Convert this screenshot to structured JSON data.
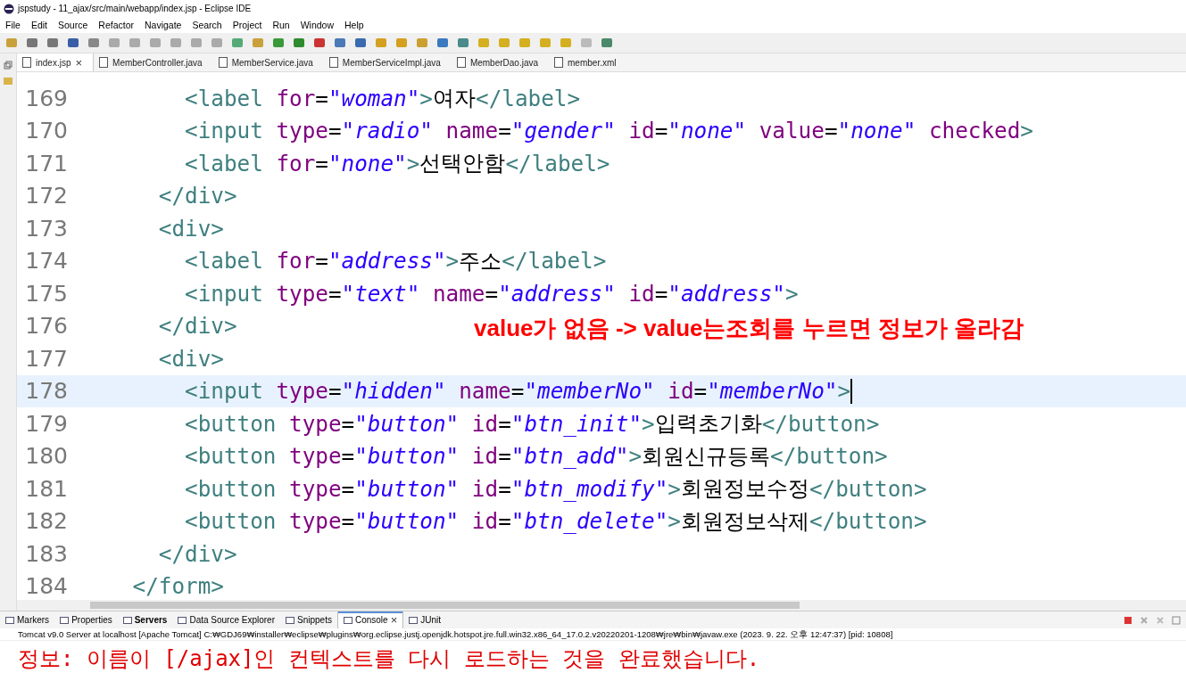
{
  "window": {
    "title": "jspstudy - 11_ajax/src/main/webapp/index.jsp - Eclipse IDE"
  },
  "menu": [
    "File",
    "Edit",
    "Source",
    "Refactor",
    "Navigate",
    "Search",
    "Project",
    "Run",
    "Window",
    "Help"
  ],
  "editor_tabs": [
    {
      "label": "index.jsp",
      "selected": true,
      "close": "×"
    },
    {
      "label": "MemberController.java",
      "selected": false
    },
    {
      "label": "MemberService.java",
      "selected": false
    },
    {
      "label": "MemberServiceImpl.java",
      "selected": false
    },
    {
      "label": "MemberDao.java",
      "selected": false
    },
    {
      "label": "member.xml",
      "selected": false
    }
  ],
  "code_lines": [
    {
      "number": "169",
      "current": false,
      "tokens": [
        {
          "kind": "tag",
          "text": "        <label"
        },
        {
          "kind": "attr",
          "text": " for"
        },
        {
          "kind": "eq",
          "text": "="
        },
        {
          "kind": "str",
          "text": "\"woman\""
        },
        {
          "kind": "tag",
          "text": ">"
        },
        {
          "kind": "text",
          "text": "여자"
        },
        {
          "kind": "tag",
          "text": "</label>"
        }
      ]
    },
    {
      "number": "170",
      "current": false,
      "tokens": [
        {
          "kind": "tag",
          "text": "        <input"
        },
        {
          "kind": "attr",
          "text": " type"
        },
        {
          "kind": "eq",
          "text": "="
        },
        {
          "kind": "str",
          "text": "\"radio\""
        },
        {
          "kind": "attr",
          "text": " name"
        },
        {
          "kind": "eq",
          "text": "="
        },
        {
          "kind": "str",
          "text": "\"gender\""
        },
        {
          "kind": "attr",
          "text": " id"
        },
        {
          "kind": "eq",
          "text": "="
        },
        {
          "kind": "str",
          "text": "\"none\""
        },
        {
          "kind": "attr",
          "text": " value"
        },
        {
          "kind": "eq",
          "text": "="
        },
        {
          "kind": "str",
          "text": "\"none\""
        },
        {
          "kind": "attr",
          "text": " checked"
        },
        {
          "kind": "tag",
          "text": ">"
        }
      ]
    },
    {
      "number": "171",
      "current": false,
      "tokens": [
        {
          "kind": "tag",
          "text": "        <label"
        },
        {
          "kind": "attr",
          "text": " for"
        },
        {
          "kind": "eq",
          "text": "="
        },
        {
          "kind": "str",
          "text": "\"none\""
        },
        {
          "kind": "tag",
          "text": ">"
        },
        {
          "kind": "text",
          "text": "선택안함"
        },
        {
          "kind": "tag",
          "text": "</label>"
        }
      ]
    },
    {
      "number": "172",
      "current": false,
      "tokens": [
        {
          "kind": "tag",
          "text": "      </div>"
        }
      ]
    },
    {
      "number": "173",
      "current": false,
      "tokens": [
        {
          "kind": "tag",
          "text": "      <div>"
        }
      ]
    },
    {
      "number": "174",
      "current": false,
      "tokens": [
        {
          "kind": "tag",
          "text": "        <label"
        },
        {
          "kind": "attr",
          "text": " for"
        },
        {
          "kind": "eq",
          "text": "="
        },
        {
          "kind": "str",
          "text": "\"address\""
        },
        {
          "kind": "tag",
          "text": ">"
        },
        {
          "kind": "text",
          "text": "주소"
        },
        {
          "kind": "tag",
          "text": "</label>"
        }
      ]
    },
    {
      "number": "175",
      "current": false,
      "tokens": [
        {
          "kind": "tag",
          "text": "        <input"
        },
        {
          "kind": "attr",
          "text": " type"
        },
        {
          "kind": "eq",
          "text": "="
        },
        {
          "kind": "str",
          "text": "\"text\""
        },
        {
          "kind": "attr",
          "text": " name"
        },
        {
          "kind": "eq",
          "text": "="
        },
        {
          "kind": "str",
          "text": "\"address\""
        },
        {
          "kind": "attr",
          "text": " id"
        },
        {
          "kind": "eq",
          "text": "="
        },
        {
          "kind": "str",
          "text": "\"address\""
        },
        {
          "kind": "tag",
          "text": ">"
        }
      ]
    },
    {
      "number": "176",
      "current": false,
      "tokens": [
        {
          "kind": "tag",
          "text": "      </div>"
        }
      ]
    },
    {
      "number": "177",
      "current": false,
      "tokens": [
        {
          "kind": "tag",
          "text": "      <div>"
        }
      ]
    },
    {
      "number": "178",
      "current": true,
      "tokens": [
        {
          "kind": "tag",
          "text": "        <input"
        },
        {
          "kind": "attr",
          "text": " type"
        },
        {
          "kind": "eq",
          "text": "="
        },
        {
          "kind": "str",
          "text": "\"hidden\""
        },
        {
          "kind": "attr",
          "text": " name"
        },
        {
          "kind": "eq",
          "text": "="
        },
        {
          "kind": "str",
          "text": "\"memberNo\""
        },
        {
          "kind": "attr",
          "text": " id"
        },
        {
          "kind": "eq",
          "text": "="
        },
        {
          "kind": "str",
          "text": "\"memberNo\""
        },
        {
          "kind": "tag",
          "text": ">"
        }
      ]
    },
    {
      "number": "179",
      "current": false,
      "tokens": [
        {
          "kind": "tag",
          "text": "        <button"
        },
        {
          "kind": "attr",
          "text": " type"
        },
        {
          "kind": "eq",
          "text": "="
        },
        {
          "kind": "str",
          "text": "\"button\""
        },
        {
          "kind": "attr",
          "text": " id"
        },
        {
          "kind": "eq",
          "text": "="
        },
        {
          "kind": "str",
          "text": "\"btn_init\""
        },
        {
          "kind": "tag",
          "text": ">"
        },
        {
          "kind": "text",
          "text": "입력초기화"
        },
        {
          "kind": "tag",
          "text": "</button>"
        }
      ]
    },
    {
      "number": "180",
      "current": false,
      "tokens": [
        {
          "kind": "tag",
          "text": "        <button"
        },
        {
          "kind": "attr",
          "text": " type"
        },
        {
          "kind": "eq",
          "text": "="
        },
        {
          "kind": "str",
          "text": "\"button\""
        },
        {
          "kind": "attr",
          "text": " id"
        },
        {
          "kind": "eq",
          "text": "="
        },
        {
          "kind": "str",
          "text": "\"btn_add\""
        },
        {
          "kind": "tag",
          "text": ">"
        },
        {
          "kind": "text",
          "text": "회원신규등록"
        },
        {
          "kind": "tag",
          "text": "</button>"
        }
      ]
    },
    {
      "number": "181",
      "current": false,
      "tokens": [
        {
          "kind": "tag",
          "text": "        <button"
        },
        {
          "kind": "attr",
          "text": " type"
        },
        {
          "kind": "eq",
          "text": "="
        },
        {
          "kind": "str",
          "text": "\"button\""
        },
        {
          "kind": "attr",
          "text": " id"
        },
        {
          "kind": "eq",
          "text": "="
        },
        {
          "kind": "str",
          "text": "\"btn_modify\""
        },
        {
          "kind": "tag",
          "text": ">"
        },
        {
          "kind": "text",
          "text": "회원정보수정"
        },
        {
          "kind": "tag",
          "text": "</button>"
        }
      ]
    },
    {
      "number": "182",
      "current": false,
      "tokens": [
        {
          "kind": "tag",
          "text": "        <button"
        },
        {
          "kind": "attr",
          "text": " type"
        },
        {
          "kind": "eq",
          "text": "="
        },
        {
          "kind": "str",
          "text": "\"button\""
        },
        {
          "kind": "attr",
          "text": " id"
        },
        {
          "kind": "eq",
          "text": "="
        },
        {
          "kind": "str",
          "text": "\"btn_delete\""
        },
        {
          "kind": "tag",
          "text": ">"
        },
        {
          "kind": "text",
          "text": "회원정보삭제"
        },
        {
          "kind": "tag",
          "text": "</button>"
        }
      ]
    },
    {
      "number": "183",
      "current": false,
      "tokens": [
        {
          "kind": "tag",
          "text": "      </div>"
        }
      ]
    },
    {
      "number": "184",
      "current": false,
      "tokens": [
        {
          "kind": "tag",
          "text": "    </form>"
        }
      ]
    }
  ],
  "annotation": "value가 없음 -> value는조회를 누르면 정보가 올라감",
  "bottom_tabs": [
    {
      "label": "Markers",
      "selected": false,
      "bold": false
    },
    {
      "label": "Properties",
      "selected": false,
      "bold": false
    },
    {
      "label": "Servers",
      "selected": false,
      "bold": true
    },
    {
      "label": "Data Source Explorer",
      "selected": false,
      "bold": false
    },
    {
      "label": "Snippets",
      "selected": false,
      "bold": false
    },
    {
      "label": "Console",
      "selected": true,
      "bold": false,
      "close": "×"
    },
    {
      "label": "JUnit",
      "selected": false,
      "bold": false
    }
  ],
  "console": {
    "header": "Tomcat v9.0 Server at localhost [Apache Tomcat] C:₩GDJ69₩installer₩eclipse₩plugins₩org.eclipse.justj.openjdk.hotspot.jre.full.win32.x86_64_17.0.2.v20220201-1208₩jre₩bin₩javaw.exe  (2023. 9. 22. 오후 12:47:37) [pid: 10808]",
    "output": "정보: 이름이 [/ajax]인 컨텍스트를 다시 로드하는 것을 완료했습니다."
  }
}
